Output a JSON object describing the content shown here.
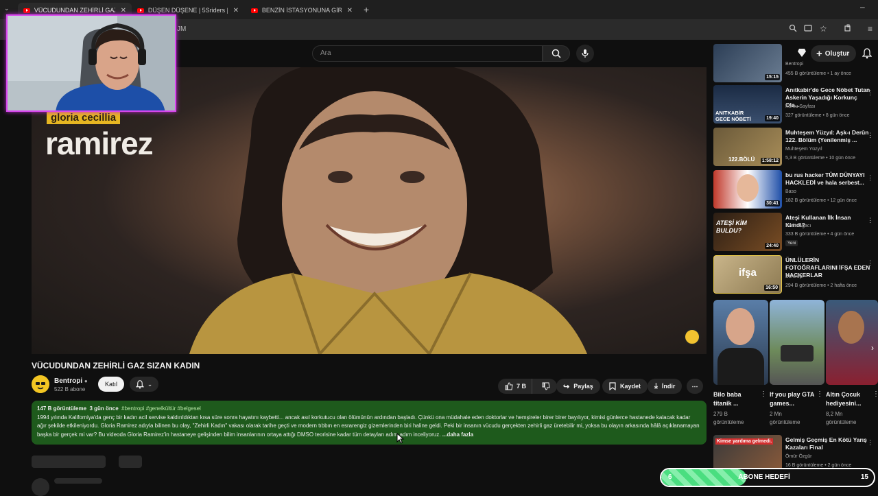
{
  "browser": {
    "tabs": [
      {
        "title": "VÜCUDUNDAN ZEHİRLİ GAZ S"
      },
      {
        "title": "DÜŞEN DÜŞENE | 5Sriders | Mo"
      },
      {
        "title": "BENZİN İSTASYONUNA GİREN"
      }
    ],
    "url_fragment": "JM"
  },
  "header": {
    "search_placeholder": "Ara",
    "create_label": "Oluştur"
  },
  "video": {
    "overlay_top": "gloria cecillia",
    "overlay_name": "ramirez",
    "title": "VÜCUDUNDAN ZEHİRLİ GAZ SIZAN KADIN",
    "channel": "Bentropi",
    "subscribers": "522 B abone",
    "join_label": "Katıl",
    "likes": "7 B",
    "share_label": "Paylaş",
    "save_label": "Kaydet",
    "download_label": "İndir"
  },
  "description": {
    "views": "147 B görüntüleme",
    "age": "3 gün önce",
    "tags": "#bentropi #genelkültür #belgesel",
    "text": "1994 yılında Kaliforniya'da genç bir kadın acil servise kaldırıldıktan kısa süre sonra hayatını kaybetti... ancak asıl korkutucu olan ölümünün ardından başladı. Çünkü ona müdahale eden doktorlar ve hemşireler birer birer bayılıyor, kimisi günlerce hastanede kalacak kadar ağır şekilde etkileniyordu. Gloria Ramirez adıyla bilinen bu olay, \"Zehirli Kadın\" vakası olarak tarihe geçti ve modern tıbbın en esrarengiz gizemlerinden biri haline geldi. Peki bir insanın vücudu gerçekten zehirli gaz üretebilir mi, yoksa bu olayın arkasında hâlâ açıklanamayan başka bir gerçek mi var? Bu videoda Gloria Ramirez'in hastaneye gelişinden bilim insanlarının ortaya attığı DMSO teorisine kadar tüm detayları adım adım inceliyoruz.",
    "more": "...daha fazla"
  },
  "sidebar": {
    "videos": [
      {
        "title": "",
        "channel": "Bentropi",
        "stats": "455 B görüntüleme • 1 ay önce",
        "duration": "15:15",
        "thumb_text": ""
      },
      {
        "title": "Anıtkabir'de Gece Nöbet Tutan Askerin Yaşadığı Korkunç Ola...",
        "channel": "Korku Sayfası",
        "stats": "327 görüntüleme • 8 gün önce",
        "duration": "19:40",
        "thumb_text": "ANITKABİR GECE NÖBETİ"
      },
      {
        "title": "Muhteşem Yüzyıl: Aşk-ı Derûn 122. Bölüm (Yenilenmiş ...",
        "channel": "Muhteşem Yüzyıl",
        "stats": "5,3 B görüntüleme • 10 gün önce",
        "duration": "1:58:12",
        "thumb_text": "122.BÖLÜ"
      },
      {
        "title": "bu rus hacker TÜM DÜNYAYI HACKLEDİ ve hala serbest...",
        "channel": "Baso",
        "stats": "182 B görüntüleme • 12 gün önce",
        "duration": "30:41",
        "thumb_text": ""
      },
      {
        "title": "Ateşi Kullanan İlk İnsan Kimdi?",
        "channel": "Evrim Ağacı",
        "stats": "333 B görüntüleme • 4 gün önce",
        "duration": "24:40",
        "thumb_text": "ATEŞİ KİM BULDU?",
        "badge": "Yeni"
      },
      {
        "title": "ÜNLÜLERİN FOTOĞRAFLARINI İFŞA EDEN HACKERLAR",
        "channel": "Bentropi",
        "stats": "294 B görüntüleme • 2 hafta önce",
        "duration": "16:50",
        "thumb_text": "ifşa"
      }
    ],
    "shorts": [
      {
        "title": "Bilo baba titanik ...",
        "views": "279 B görüntüleme"
      },
      {
        "title": "If you play GTA games...",
        "views": "2 Mn görüntüleme"
      },
      {
        "title": "Altın Çocuk hediyesini...",
        "views": "8,2 Mn görüntüleme"
      }
    ],
    "last_video": {
      "title": "Gelmiş Geçmiş En Kötü Yarış Kazaları Final",
      "channel": "Ömür Özgür",
      "stats": "16 B görüntüleme • 2 gün önce",
      "thumb_text": "Kimse yardıma gelmedi."
    }
  },
  "subgoal": {
    "label": "ABONE HEDEFİ",
    "current": "6",
    "target": "15",
    "progress": 0.4
  }
}
